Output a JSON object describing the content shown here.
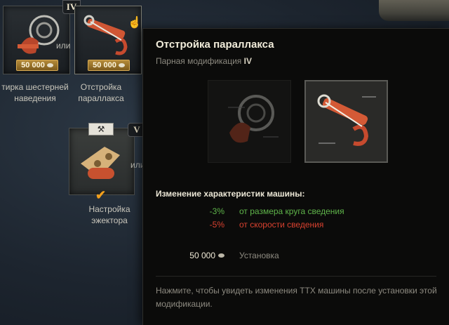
{
  "tree": {
    "nodes": [
      {
        "tier": "IV",
        "price": "50 000",
        "label_line1": "тирка шестерней",
        "label_line2": "наведения"
      },
      {
        "price": "50 000",
        "label_line1": "Отстройка",
        "label_line2": "параллакса"
      },
      {
        "tier": "V",
        "label_line1": "Настройка",
        "label_line2": "эжектора"
      }
    ],
    "or_label": "или",
    "or_label_partial": "или"
  },
  "tooltip": {
    "title": "Отстройка параллакса",
    "subtitle_prefix": "Парная модификация",
    "subtitle_tier": "IV",
    "changes_header": "Изменение характеристик машины:",
    "changes": [
      {
        "value": "-3%",
        "desc": "от размера круга сведения",
        "kind": "good"
      },
      {
        "value": "-5%",
        "desc": "от скорости сведения",
        "kind": "bad"
      }
    ],
    "cost_amount": "50 000",
    "cost_label": "Установка",
    "footer": "Нажмите, чтобы увидеть изменения ТТХ машины после установки этой модификации."
  },
  "colors": {
    "positive": "#5fb44a",
    "negative": "#d9412f",
    "accent": "#f3a01c"
  }
}
